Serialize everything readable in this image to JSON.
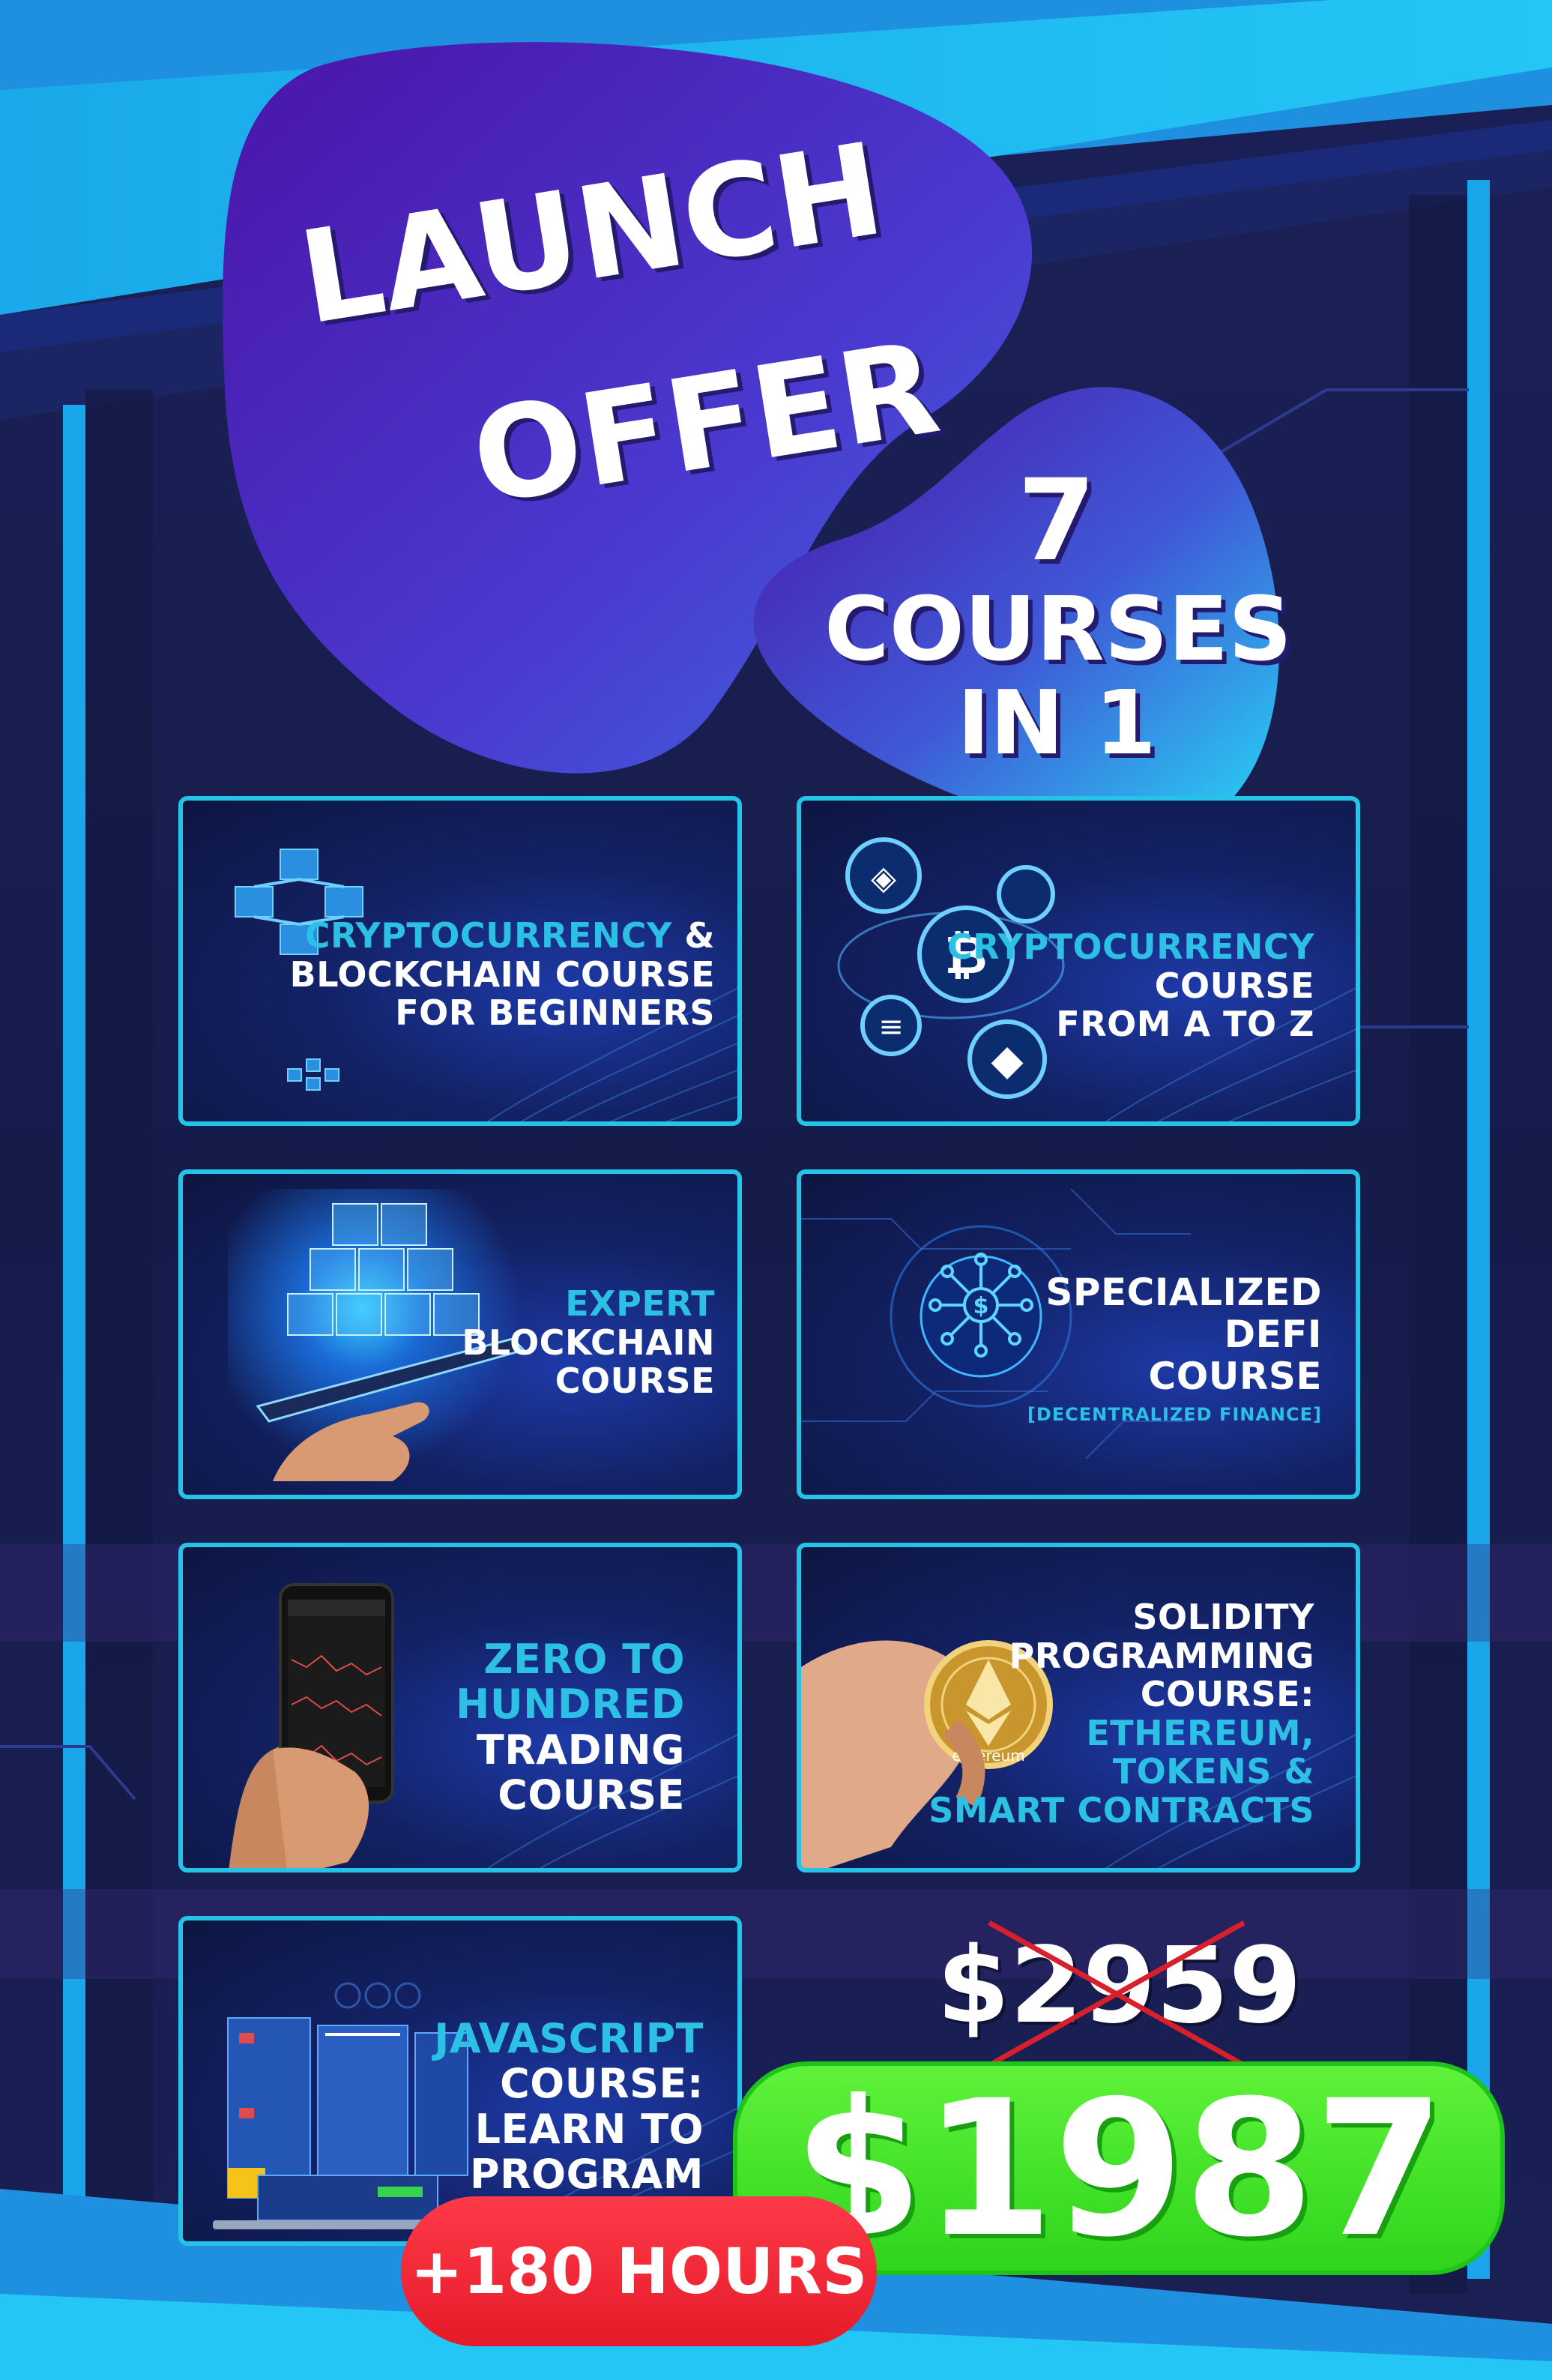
{
  "headline": {
    "line1": "LAUNCH",
    "line2": "OFFER"
  },
  "badge": {
    "number": "7",
    "line2": "COURSES",
    "line3": "IN 1"
  },
  "courses": [
    {
      "title_accent": "CRYPTOCURRENCY",
      "title_rest_1": " &",
      "title_rest_2": "BLOCKCHAIN COURSE",
      "title_rest_3": "FOR BEGINNERS"
    },
    {
      "title_accent": "CRYPTOCURRENCY",
      "title_rest_1": "COURSE",
      "title_rest_2": "FROM A TO Z"
    },
    {
      "title_accent": "EXPERT",
      "title_rest_1": "BLOCKCHAIN",
      "title_rest_2": "COURSE"
    },
    {
      "title_rest_1": "SPECIALIZED",
      "title_rest_2": "DEFI",
      "title_rest_3": "COURSE",
      "subtitle": "[DECENTRALIZED FINANCE]"
    },
    {
      "title_accent_1": "ZERO TO",
      "title_accent_2": "HUNDRED",
      "title_rest_1": "TRADING",
      "title_rest_2": "COURSE"
    },
    {
      "title_rest_1": "SOLIDITY",
      "title_rest_2": "PROGRAMMING",
      "title_rest_3": "COURSE:",
      "title_accent_1": "ETHEREUM,",
      "title_accent_2": "TOKENS &",
      "title_accent_3": "SMART CONTRACTS"
    },
    {
      "title_accent": "JAVASCRIPT",
      "title_rest_1": "COURSE:",
      "title_rest_2": "LEARN TO",
      "title_rest_3": "PROGRAM"
    }
  ],
  "pricing": {
    "old_price": "$2959",
    "new_price": "$1987"
  },
  "hours_badge": "+180 HOURS",
  "coin_label": "ethereum",
  "colors": {
    "accent": "#2bc0e4",
    "price_green": "#37e11f",
    "hours_red": "#ee2232",
    "blob_start": "#3b1aa0",
    "blob_end": "#27d8f6"
  }
}
